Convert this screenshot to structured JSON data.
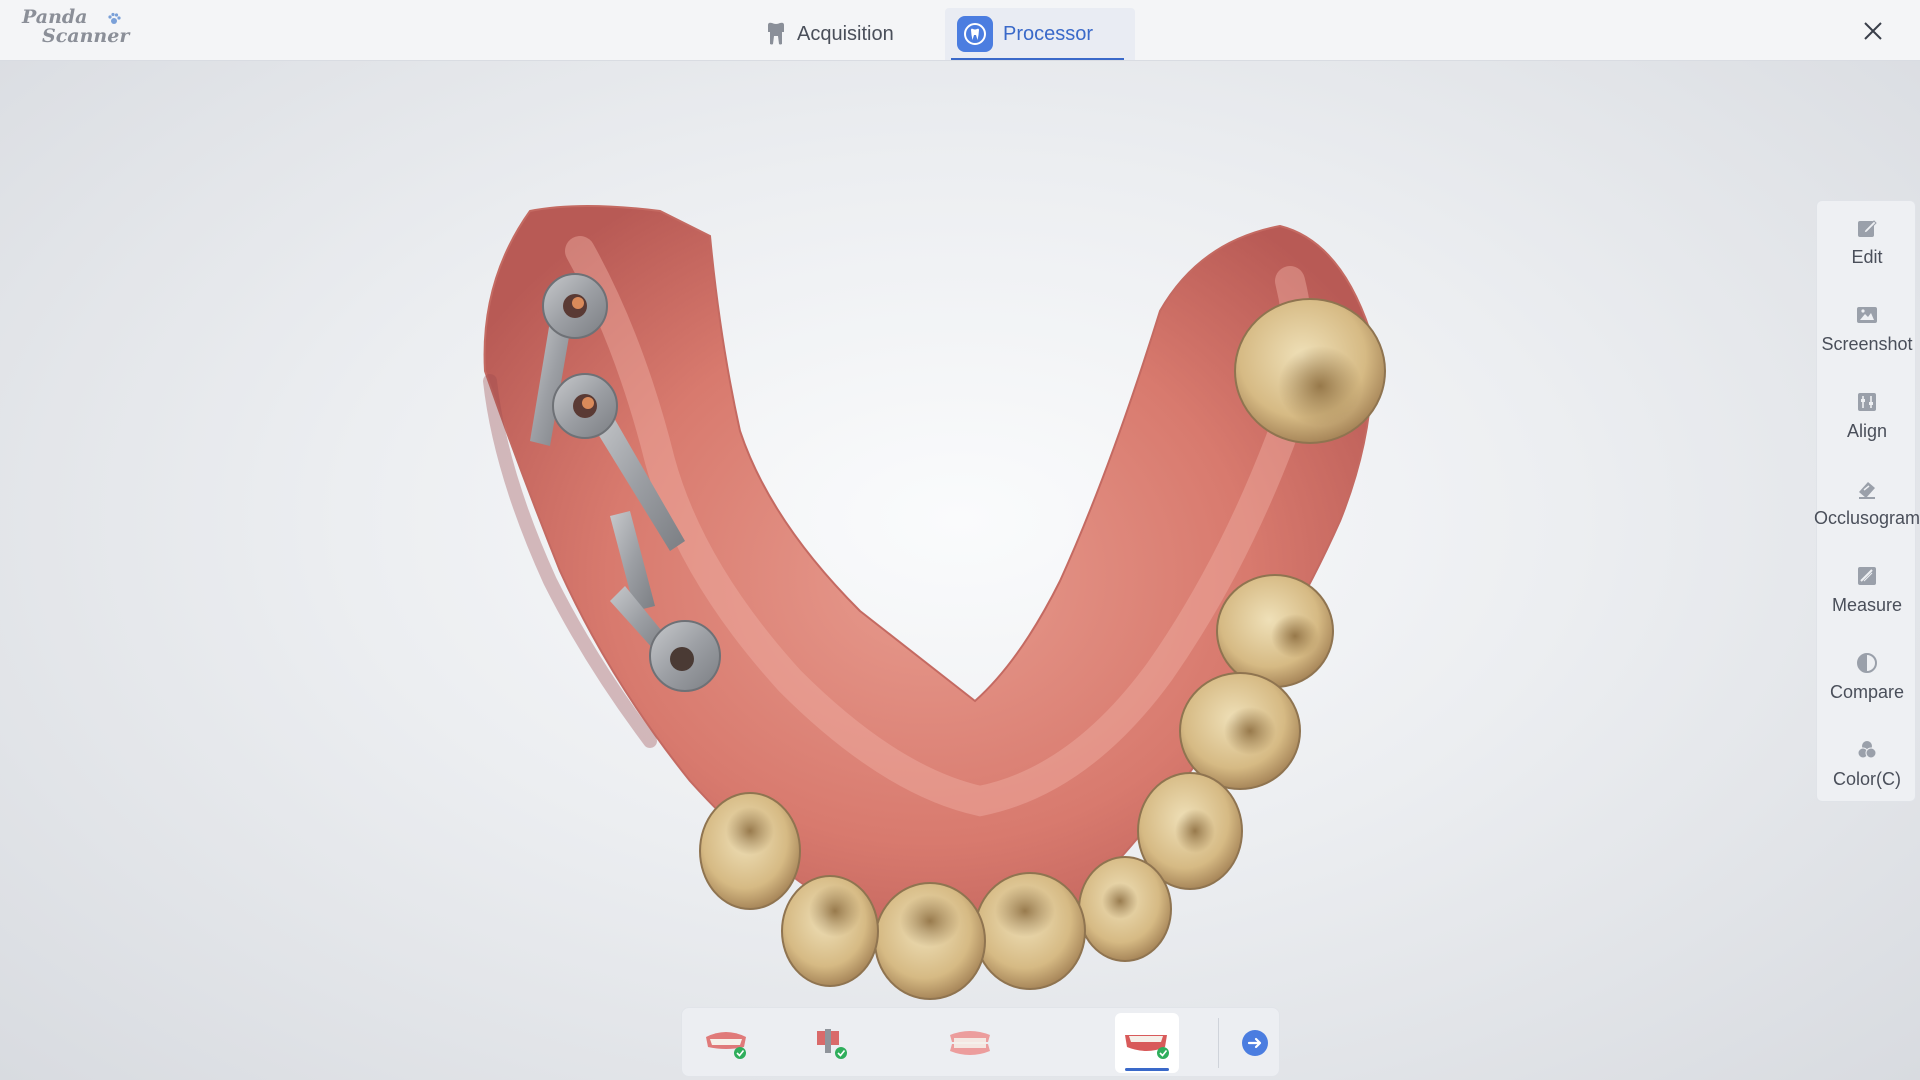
{
  "app": {
    "logo_line1": "Panda",
    "logo_line2": "Scanner"
  },
  "tabs": [
    {
      "label": "Acquisition",
      "icon": "tooth-icon",
      "active": false
    },
    {
      "label": "Processor",
      "icon": "tooth-app-icon",
      "active": true
    }
  ],
  "toolbar": {
    "items": [
      {
        "label": "Edit",
        "icon": "edit-icon"
      },
      {
        "label": "Screenshot",
        "icon": "screenshot-icon"
      },
      {
        "label": "Align",
        "icon": "align-icon"
      },
      {
        "label": "Occlusogram",
        "icon": "occlusogram-icon"
      },
      {
        "label": "Measure",
        "icon": "measure-icon"
      },
      {
        "label": "Compare",
        "icon": "compare-icon"
      },
      {
        "label": "Color(C)",
        "icon": "color-icon"
      }
    ]
  },
  "bottom_bar": {
    "items": [
      {
        "icon": "upper-jaw-check-icon",
        "active": false
      },
      {
        "icon": "scanbody-check-icon",
        "active": false
      },
      {
        "icon": "bite-icon",
        "active": false
      },
      {
        "icon": "lower-jaw-check-icon",
        "active": true
      },
      {
        "icon": "next-arrow-icon",
        "active": false
      }
    ]
  },
  "colors": {
    "accent": "#3a69c9",
    "check": "#2fae5c",
    "gum": "#d9786e",
    "tooth": "#d9c08a"
  }
}
